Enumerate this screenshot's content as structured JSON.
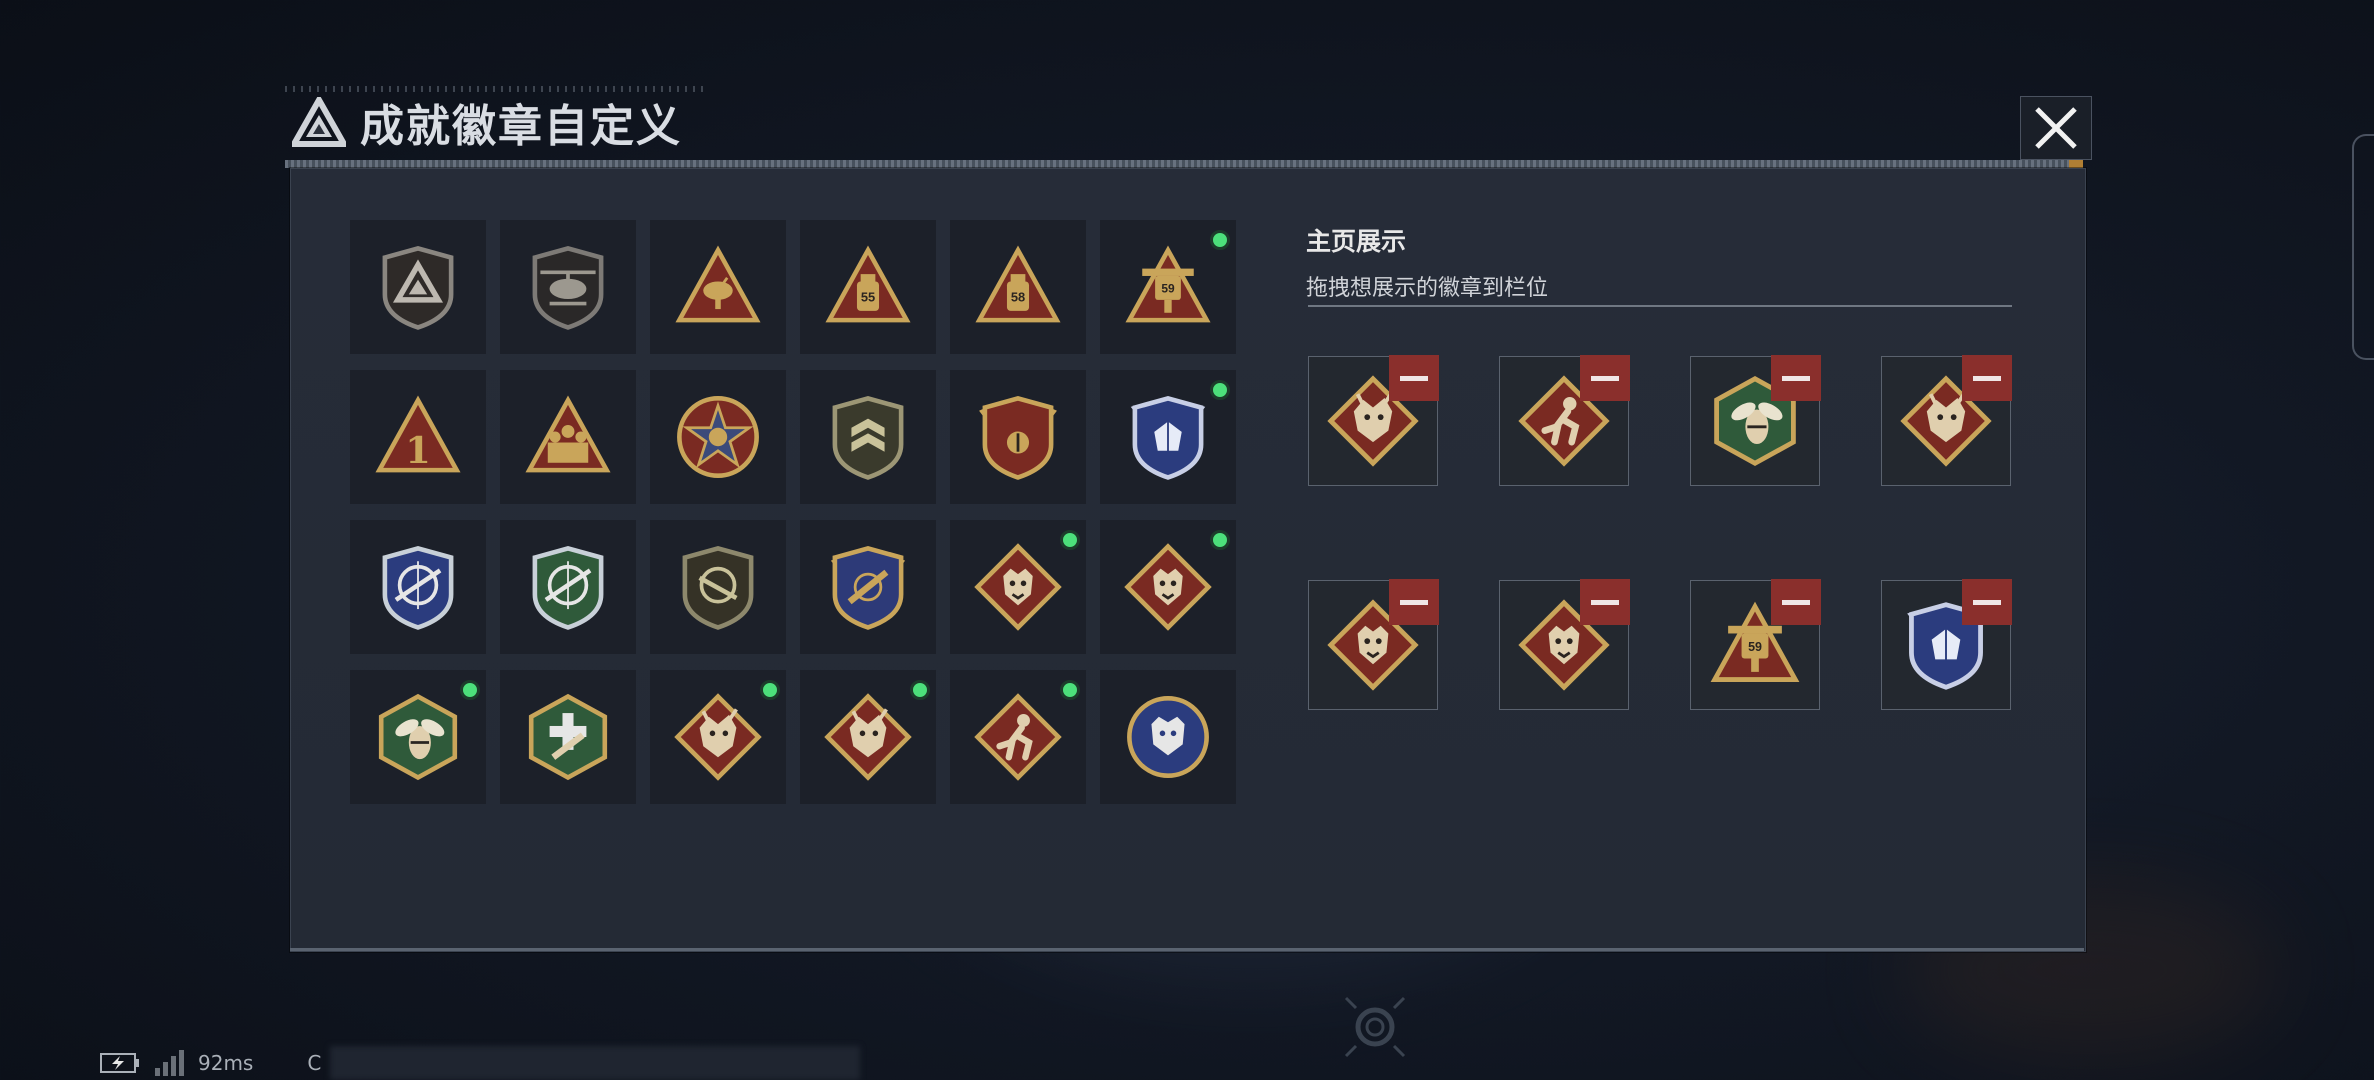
{
  "title": "成就徽章自定义",
  "icons": {
    "logo": "triangle-logo-icon",
    "close": "close-icon"
  },
  "colors": {
    "indicator_new": "#4ce07a",
    "remove": "#8a2f2c",
    "gold": "#c9a55a",
    "crimson": "#7a2a22"
  },
  "badges": [
    {
      "icon": "shield-triangle-badge",
      "new": false
    },
    {
      "icon": "helicopter-badge",
      "new": false
    },
    {
      "icon": "satellite-dish-badge",
      "new": false
    },
    {
      "icon": "triangle-55-badge",
      "new": false
    },
    {
      "icon": "triangle-58-badge",
      "new": false
    },
    {
      "icon": "tank-59-badge",
      "new": true
    },
    {
      "icon": "triangle-1-badge",
      "new": false
    },
    {
      "icon": "triangle-soldiers-badge",
      "new": false
    },
    {
      "icon": "star-medal-badge",
      "new": false
    },
    {
      "icon": "shield-chevron-badge",
      "new": false
    },
    {
      "icon": "winged-shield-badge",
      "new": false
    },
    {
      "icon": "blue-crystal-badge",
      "new": true
    },
    {
      "icon": "blue-crosshair-rifle-badge",
      "new": false
    },
    {
      "icon": "green-crosshair-rifle-badge",
      "new": false
    },
    {
      "icon": "circle-rifle-badge",
      "new": false
    },
    {
      "icon": "gold-rifle-shield-badge",
      "new": false
    },
    {
      "icon": "wolf-diamond-badge",
      "new": true
    },
    {
      "icon": "wolf-diamond-badge",
      "new": true
    },
    {
      "icon": "hornet-hexagon-badge",
      "new": true
    },
    {
      "icon": "medic-hexagon-badge",
      "new": false
    },
    {
      "icon": "dragon-diamond-badge",
      "new": true
    },
    {
      "icon": "dragon-diamond-badge",
      "new": true
    },
    {
      "icon": "runner-diamond-badge",
      "new": true
    },
    {
      "icon": "wolf-circle-badge",
      "new": false
    }
  ],
  "showcase": {
    "title": "主页展示",
    "subtitle": "拖拽想展示的徽章到栏位",
    "slots": [
      {
        "icon": "dragon-diamond-badge"
      },
      {
        "icon": "runner-diamond-badge"
      },
      {
        "icon": "hornet-hexagon-badge"
      },
      {
        "icon": "dragon-diamond-badge"
      },
      {
        "icon": "wolf-diamond-badge"
      },
      {
        "icon": "wolf-diamond-badge"
      },
      {
        "icon": "tank-59-badge"
      },
      {
        "icon": "blue-crystal-badge"
      }
    ]
  },
  "hud": {
    "ping": "92ms",
    "channel": "C"
  }
}
